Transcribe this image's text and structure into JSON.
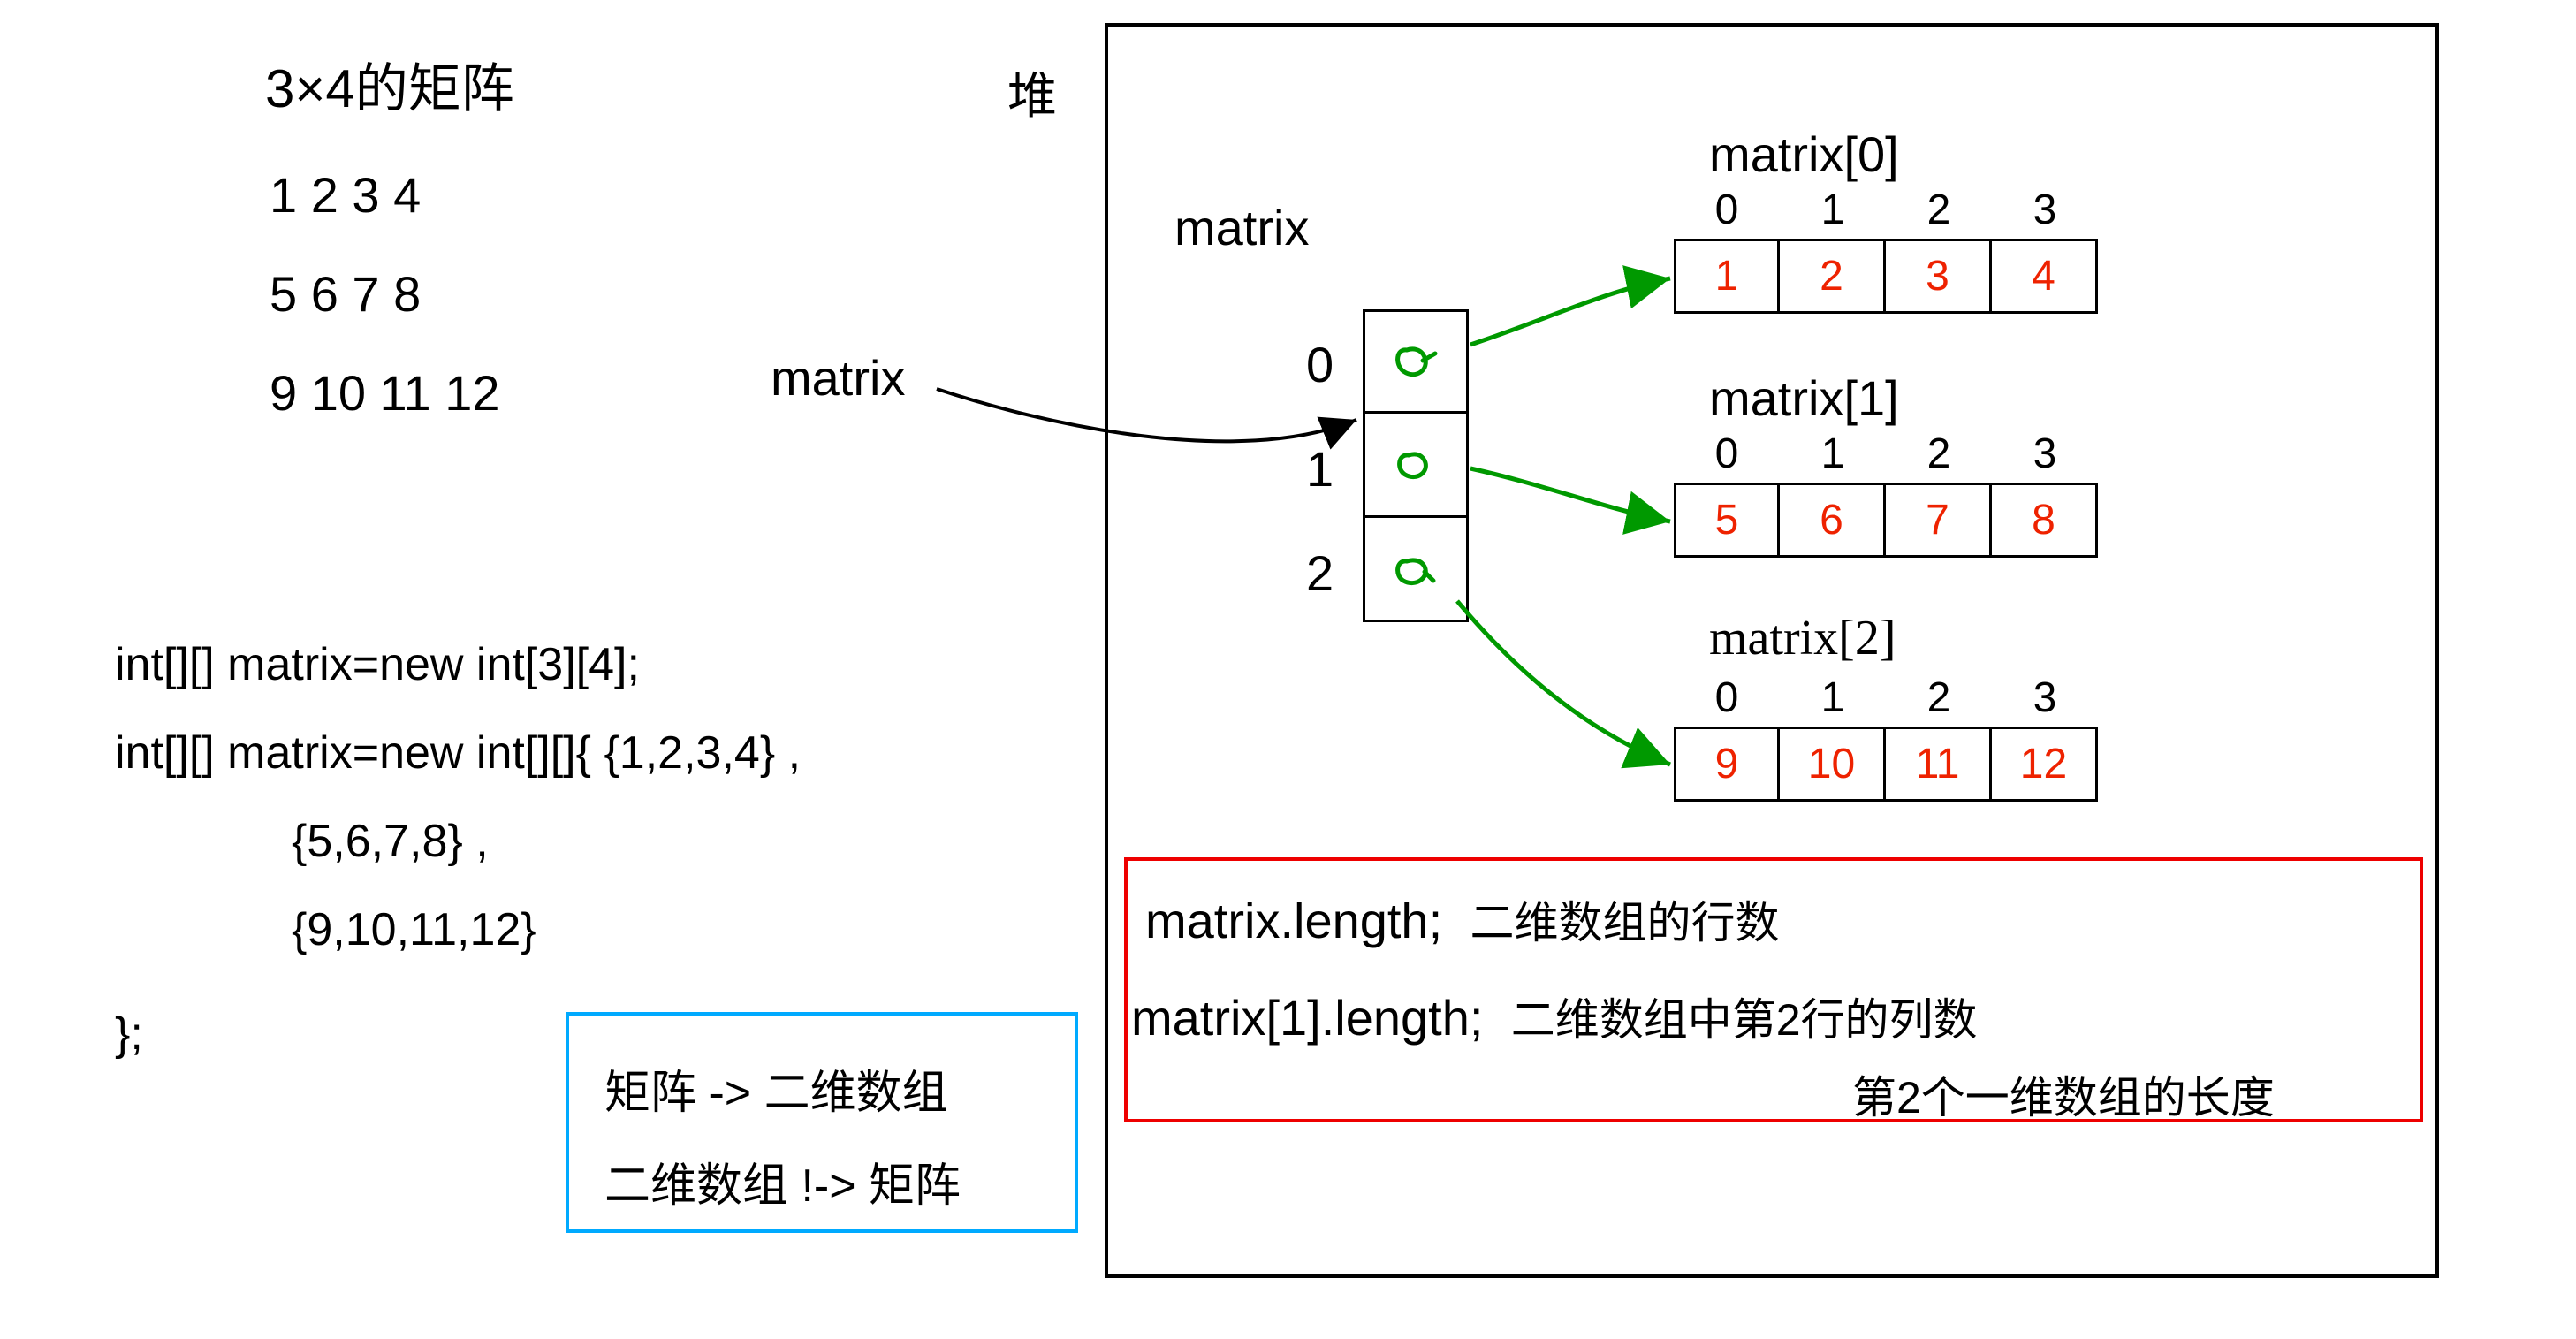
{
  "title": "3×4的矩阵",
  "matrix_rows": [
    "1 2 3 4",
    "5 6 7 8",
    "9 10 11 12"
  ],
  "heap_label": "堆",
  "matrix_ptr_label": "matrix",
  "matrix_header": "matrix",
  "outer_indices": [
    "0",
    "1",
    "2"
  ],
  "sub_labels": [
    "matrix[0]",
    "matrix[1]",
    "matrix[2]"
  ],
  "inner_indices": [
    "0",
    "1",
    "2",
    "3"
  ],
  "sub_arrays": [
    [
      "1",
      "2",
      "3",
      "4"
    ],
    [
      "5",
      "6",
      "7",
      "8"
    ],
    [
      "9",
      "10",
      "11",
      "12"
    ]
  ],
  "code": {
    "l1": "int[][]  matrix=new int[3][4];",
    "l2": "int[][] matrix=new int[][]{ {1,2,3,4} ,",
    "l3": "{5,6,7,8} ,",
    "l4": "{9,10,11,12}",
    "l5": "};"
  },
  "blue_box": {
    "l1": "矩阵 -> 二维数组",
    "l2": "二维数组 !-> 矩阵"
  },
  "red_explain": {
    "l1a": "matrix.length;",
    "l1b": "二维数组的行数",
    "l2a": "matrix[1].length;",
    "l2b": "二维数组中第2行的列数",
    "l3": "第2个一维数组的长度"
  }
}
